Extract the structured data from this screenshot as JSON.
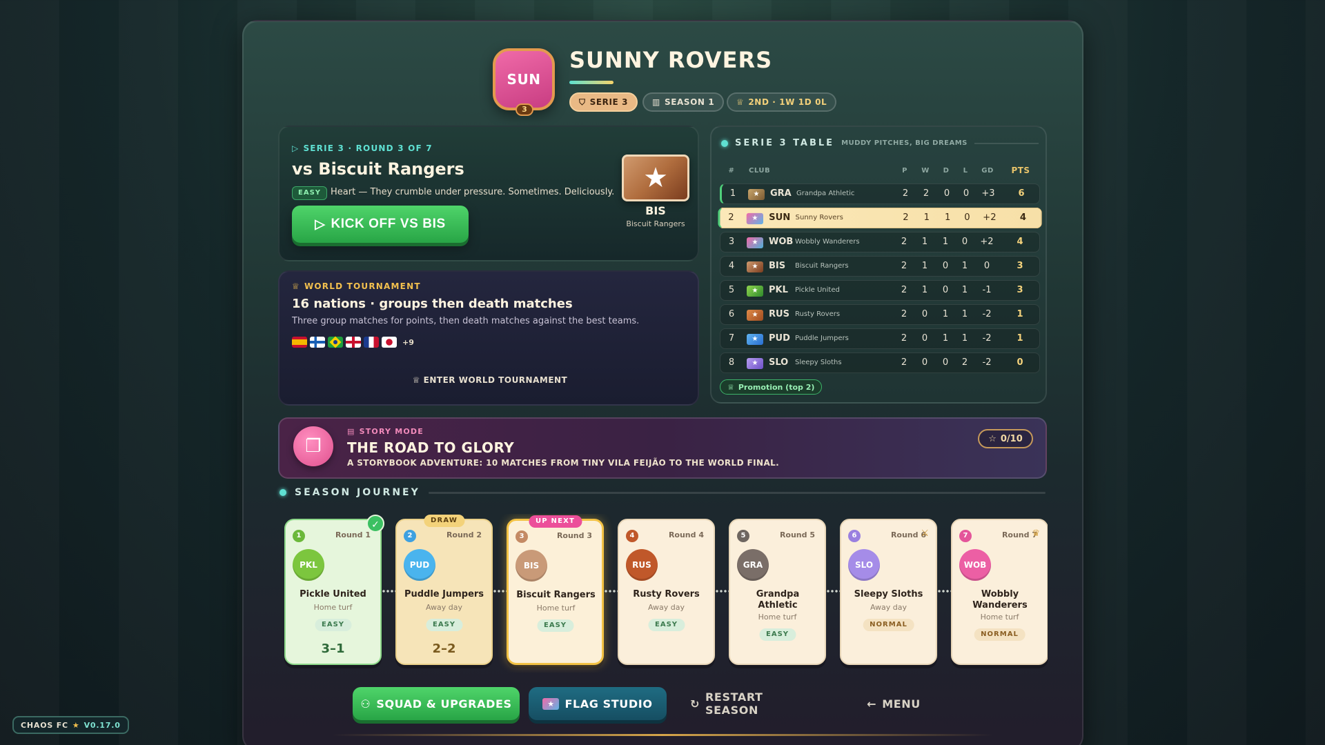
{
  "team": {
    "crest_abbr": "SUN",
    "crest_level": "3",
    "name": "SUNNY ROVERS",
    "chips": {
      "serie": "SERIE 3",
      "season": "SEASON 1",
      "record": "2ND · 1W 1D 0L"
    }
  },
  "next_match": {
    "eyebrow": "SERIE 3 · ROUND 3 OF 7",
    "title": "vs Biscuit Rangers",
    "difficulty": "EASY",
    "description": "Heart — They crumble under pressure. Sometimes. Deliciously.",
    "kickoff_label": "KICK OFF VS BIS",
    "opponent_abbr": "BIS",
    "opponent_name": "Biscuit Rangers"
  },
  "world_tournament": {
    "eyebrow": "WORLD TOURNAMENT",
    "title": "16 nations · groups then death matches",
    "description": "Three group matches for points, then death matches against the best teams.",
    "more_flags": "+9",
    "enter_label": "ENTER WORLD TOURNAMENT"
  },
  "league_table": {
    "title": "SERIE 3 TABLE",
    "subtitle": "MUDDY PITCHES, BIG DREAMS",
    "columns": {
      "rank": "#",
      "club": "CLUB",
      "p": "P",
      "w": "W",
      "d": "D",
      "l": "L",
      "gd": "GD",
      "pts": "PTS"
    },
    "rows": [
      {
        "rank": "1",
        "abbr": "GRA",
        "name": "Grandpa Athletic",
        "p": "2",
        "w": "2",
        "d": "0",
        "l": "0",
        "gd": "+3",
        "pts": "6"
      },
      {
        "rank": "2",
        "abbr": "SUN",
        "name": "Sunny Rovers",
        "p": "2",
        "w": "1",
        "d": "1",
        "l": "0",
        "gd": "+2",
        "pts": "4"
      },
      {
        "rank": "3",
        "abbr": "WOB",
        "name": "Wobbly Wanderers",
        "p": "2",
        "w": "1",
        "d": "1",
        "l": "0",
        "gd": "+2",
        "pts": "4"
      },
      {
        "rank": "4",
        "abbr": "BIS",
        "name": "Biscuit Rangers",
        "p": "2",
        "w": "1",
        "d": "0",
        "l": "1",
        "gd": "0",
        "pts": "3"
      },
      {
        "rank": "5",
        "abbr": "PKL",
        "name": "Pickle United",
        "p": "2",
        "w": "1",
        "d": "0",
        "l": "1",
        "gd": "-1",
        "pts": "3"
      },
      {
        "rank": "6",
        "abbr": "RUS",
        "name": "Rusty Rovers",
        "p": "2",
        "w": "0",
        "d": "1",
        "l": "1",
        "gd": "-2",
        "pts": "1"
      },
      {
        "rank": "7",
        "abbr": "PUD",
        "name": "Puddle Jumpers",
        "p": "2",
        "w": "0",
        "d": "1",
        "l": "1",
        "gd": "-2",
        "pts": "1"
      },
      {
        "rank": "8",
        "abbr": "SLO",
        "name": "Sleepy Sloths",
        "p": "2",
        "w": "0",
        "d": "0",
        "l": "2",
        "gd": "-2",
        "pts": "0"
      }
    ],
    "promotion_label": "Promotion (top 2)"
  },
  "story": {
    "eyebrow": "STORY MODE",
    "title": "THE ROAD TO GLORY",
    "subtitle": "A STORYBOOK ADVENTURE: 10 MATCHES FROM TINY VILA FEIJÃO TO THE WORLD FINAL.",
    "progress": "0/10"
  },
  "journey": {
    "title": "SEASON JOURNEY",
    "cards": [
      {
        "num": "1",
        "round": "Round 1",
        "abbr": "PKL",
        "name": "Pickle United",
        "venue": "Home turf",
        "difficulty": "EASY",
        "score": "3–1"
      },
      {
        "num": "2",
        "round": "Round 2",
        "abbr": "PUD",
        "name": "Puddle Jumpers",
        "venue": "Away day",
        "difficulty": "EASY",
        "score": "2–2",
        "tag": "DRAW"
      },
      {
        "num": "3",
        "round": "Round 3",
        "abbr": "BIS",
        "name": "Biscuit Rangers",
        "venue": "Home turf",
        "difficulty": "EASY",
        "tag": "UP NEXT"
      },
      {
        "num": "4",
        "round": "Round 4",
        "abbr": "RUS",
        "name": "Rusty Rovers",
        "venue": "Away day",
        "difficulty": "EASY"
      },
      {
        "num": "5",
        "round": "Round 5",
        "abbr": "GRA",
        "name": "Grandpa Athletic",
        "venue": "Home turf",
        "difficulty": "EASY"
      },
      {
        "num": "6",
        "round": "Round 6",
        "abbr": "SLO",
        "name": "Sleepy Sloths",
        "venue": "Away day",
        "difficulty": "NORMAL"
      },
      {
        "num": "7",
        "round": "Round 7",
        "abbr": "WOB",
        "name": "Wobbly Wanderers",
        "venue": "Home turf",
        "difficulty": "NORMAL"
      }
    ]
  },
  "actions": {
    "squad": "SQUAD & UPGRADES",
    "flag_studio": "FLAG STUDIO",
    "restart": "RESTART SEASON",
    "menu": "MENU"
  },
  "footer": {
    "app": "CHAOS FC",
    "version": "V0.17.0"
  },
  "colors": {
    "accent_teal": "#5fe0d2",
    "kickoff_green": "#28a546",
    "highlight_gold": "#f3c244",
    "story_pink": "#ec4f9a"
  }
}
